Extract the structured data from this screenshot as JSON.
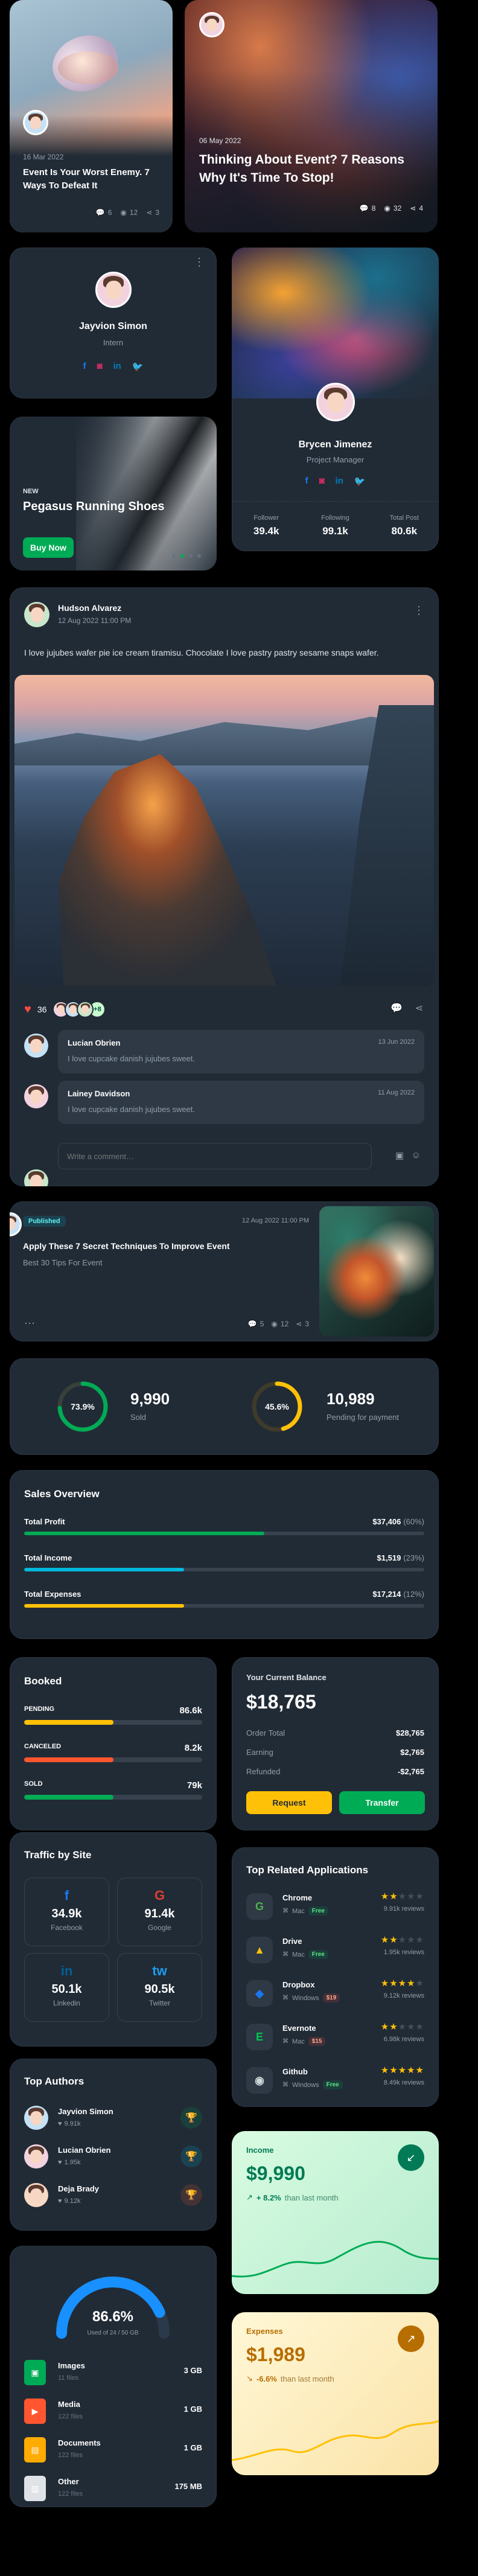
{
  "colors": {
    "primary": "#00ab55",
    "warning": "#ffc107",
    "error": "#ff4842",
    "info": "#1890ff",
    "cyan": "#00b8d9"
  },
  "post_small": {
    "date": "16 Mar 2022",
    "title": "Event Is Your Worst Enemy. 7 Ways To Defeat It",
    "comments": "6",
    "views": "12",
    "shares": "3"
  },
  "post_large": {
    "date": "06 May 2022",
    "title": "Thinking About Event? 7 Reasons Why It's Time To Stop!",
    "comments": "8",
    "views": "32",
    "shares": "4"
  },
  "profile1": {
    "name": "Jayvion Simon",
    "role": "Intern",
    "socials": [
      "f",
      "ig",
      "in",
      "tw"
    ]
  },
  "profile2": {
    "name": "Brycen Jimenez",
    "role": "Project Manager",
    "stats": [
      {
        "label": "Follower",
        "value": "39.4k"
      },
      {
        "label": "Following",
        "value": "99.1k"
      },
      {
        "label": "Total Post",
        "value": "80.6k"
      }
    ]
  },
  "promo": {
    "badge": "NEW",
    "title": "Pegasus Running Shoes",
    "button": "Buy Now"
  },
  "feed": {
    "author": "Hudson Alvarez",
    "date": "12 Aug 2022 11:00 PM",
    "text": "I love jujubes wafer pie ice cream tiramisu. Chocolate I love pastry pastry sesame snaps wafer.",
    "likes": "36",
    "more_likers": "+8",
    "comments": [
      {
        "name": "Lucian Obrien",
        "date": "13 Jun 2022",
        "text": "I love cupcake danish jujubes sweet."
      },
      {
        "name": "Lainey Davidson",
        "date": "11 Aug 2022",
        "text": "I love cupcake danish jujubes sweet."
      }
    ],
    "input_placeholder": "Write a comment…"
  },
  "article": {
    "status": "Published",
    "date": "12 Aug 2022 11:00 PM",
    "title": "Apply These 7 Secret Techniques To Improve Event",
    "subtitle": "Best 30 Tips For Event",
    "comments": "5",
    "views": "12",
    "shares": "3"
  },
  "counters": [
    {
      "percent": 73.9,
      "percent_label": "73.9%",
      "value": "9,990",
      "label": "Sold",
      "color": "#00ab55"
    },
    {
      "percent": 45.6,
      "percent_label": "45.6%",
      "value": "10,989",
      "label": "Pending for payment",
      "color": "#ffc107"
    }
  ],
  "sales": {
    "title": "Sales Overview",
    "rows": [
      {
        "label": "Total Profit",
        "amount": "$37,406",
        "pct_label": "(60%)",
        "pct": 60,
        "color": "#00ab55"
      },
      {
        "label": "Total Income",
        "amount": "$1,519",
        "pct_label": "(23%)",
        "pct": 23,
        "color": "#00b8d9"
      },
      {
        "label": "Total Expenses",
        "amount": "$17,214",
        "pct_label": "(12%)",
        "pct": 12,
        "color": "#ffc107"
      }
    ]
  },
  "booked": {
    "title": "Booked",
    "rows": [
      {
        "label": "PENDING",
        "value": "86.6k",
        "pct": 50,
        "color": "#ffc107"
      },
      {
        "label": "CANCELED",
        "value": "8.2k",
        "pct": 50,
        "color": "#ff5630"
      },
      {
        "label": "SOLD",
        "value": "79k",
        "pct": 50,
        "color": "#00ab55"
      }
    ]
  },
  "balance": {
    "title": "Your Current Balance",
    "amount": "$18,765",
    "rows": [
      {
        "label": "Order Total",
        "value": "$28,765"
      },
      {
        "label": "Earning",
        "value": "$2,765"
      },
      {
        "label": "Refunded",
        "value": "-$2,765"
      }
    ],
    "request": "Request",
    "transfer": "Transfer"
  },
  "traffic": {
    "title": "Traffic by Site",
    "sites": [
      {
        "icon": "f",
        "value": "34.9k",
        "name": "Facebook",
        "color": "#1877f2"
      },
      {
        "icon": "G",
        "value": "91.4k",
        "name": "Google",
        "color": "#df3e30"
      },
      {
        "icon": "in",
        "value": "50.1k",
        "name": "Linkedin",
        "color": "#006097"
      },
      {
        "icon": "tw",
        "value": "90.5k",
        "name": "Twitter",
        "color": "#1c9cea"
      }
    ]
  },
  "apps": {
    "title": "Top Related Applications",
    "items": [
      {
        "name": "Chrome",
        "os": "Mac",
        "price": "Free",
        "rating": 2,
        "reviews": "9.91k reviews",
        "icon": "G",
        "icon_color": "#4caf50"
      },
      {
        "name": "Drive",
        "os": "Mac",
        "price": "Free",
        "rating": 2,
        "reviews": "1.95k reviews",
        "icon": "▲",
        "icon_color": "#ffc107"
      },
      {
        "name": "Dropbox",
        "os": "Windows",
        "price": "$19",
        "rating": 4,
        "reviews": "9.12k reviews",
        "icon": "◆",
        "icon_color": "#1877f2"
      },
      {
        "name": "Evernote",
        "os": "Mac",
        "price": "$15",
        "rating": 2,
        "reviews": "6.98k reviews",
        "icon": "E",
        "icon_color": "#00c853"
      },
      {
        "name": "Github",
        "os": "Windows",
        "price": "Free",
        "rating": 5,
        "reviews": "8.49k reviews",
        "icon": "◉",
        "icon_color": "#cfd8dc"
      }
    ]
  },
  "authors": {
    "title": "Top Authors",
    "items": [
      {
        "name": "Jayvion Simon",
        "likes": "9.91k",
        "trophy_color": "#00ab55"
      },
      {
        "name": "Lucian Obrien",
        "likes": "1.95k",
        "trophy_color": "#00b8d9"
      },
      {
        "name": "Deja Brady",
        "likes": "9.12k",
        "trophy_color": "#ff5630"
      }
    ]
  },
  "income": {
    "title": "Income",
    "amount": "$9,990",
    "change": "+ 8.2%",
    "note": "than last month"
  },
  "expenses": {
    "title": "Expenses",
    "amount": "$1,989",
    "change": "-6.6%",
    "note": "than last month"
  },
  "storage": {
    "percent": 86.6,
    "percent_label": "86.6%",
    "used": "Used of 24 / 50 GB",
    "files": [
      {
        "name": "Images",
        "count": "11 files",
        "size": "3 GB",
        "color": "#00ab55"
      },
      {
        "name": "Media",
        "count": "122 files",
        "size": "1 GB",
        "color": "#ff5630"
      },
      {
        "name": "Documents",
        "count": "122 files",
        "size": "1 GB",
        "color": "#ffab00"
      },
      {
        "name": "Other",
        "count": "122 files",
        "size": "175 MB",
        "color": "#dfe3e8"
      }
    ]
  }
}
